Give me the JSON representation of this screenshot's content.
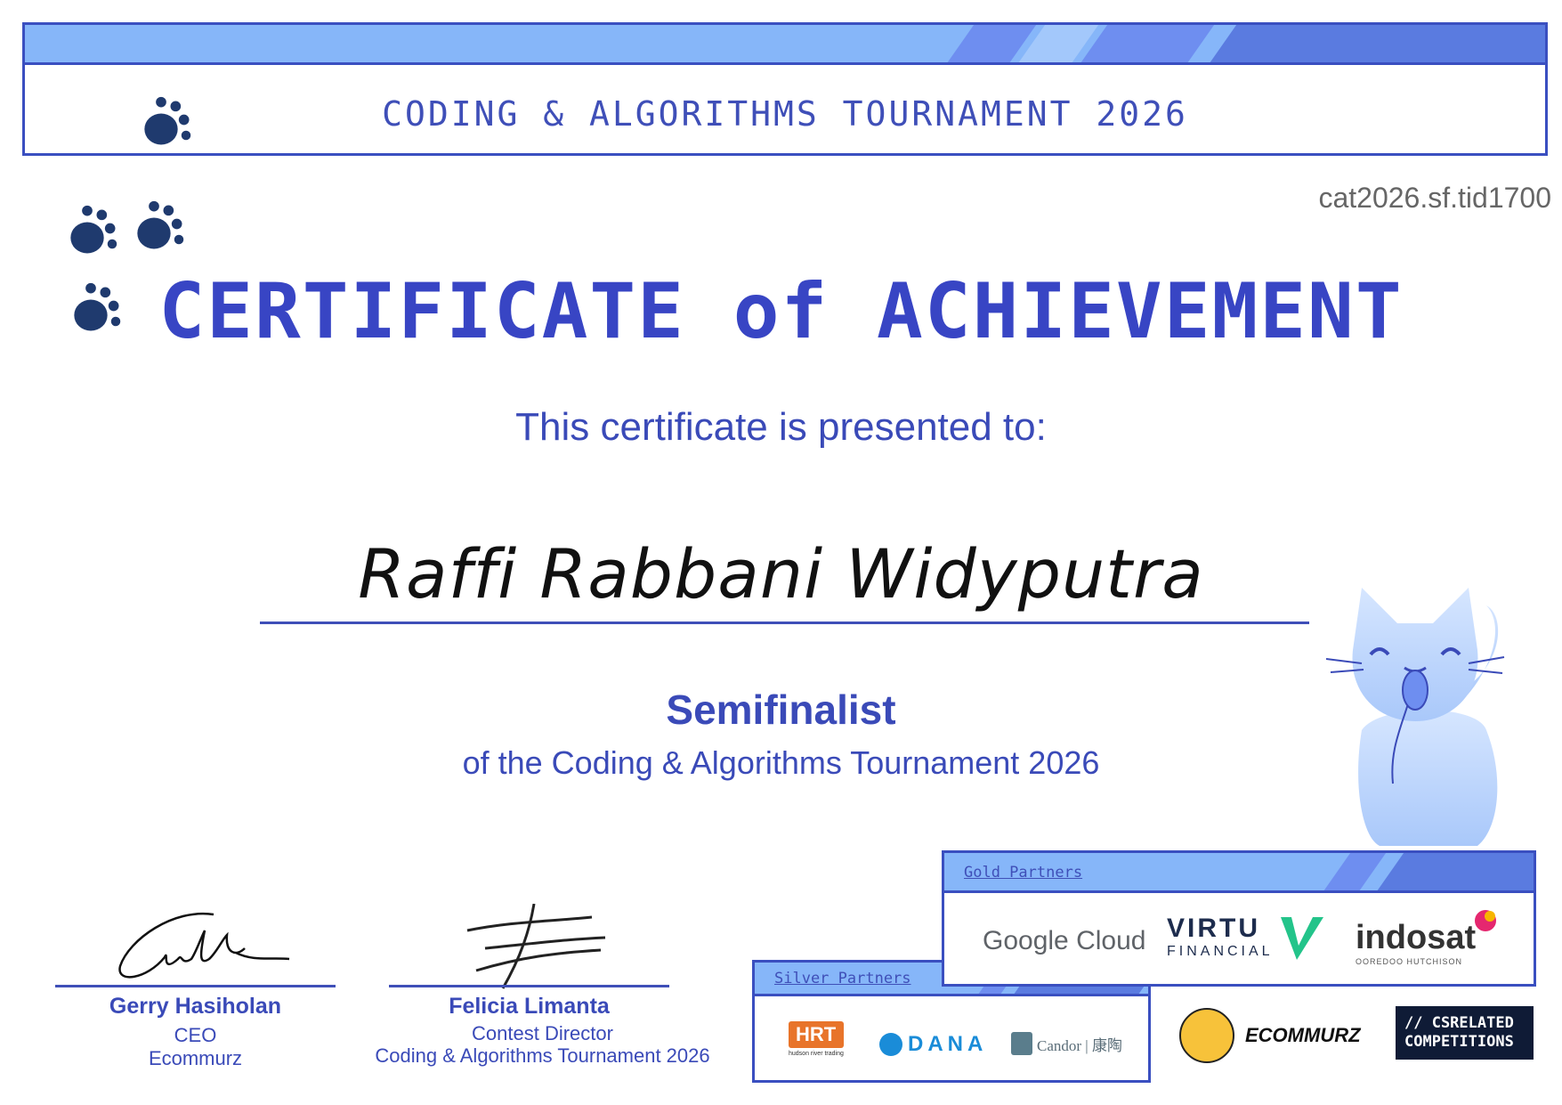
{
  "banner": {
    "title": "CODING & ALGORITHMS TOURNAMENT 2026"
  },
  "certificate": {
    "id": "cat2026.sf.tid1700",
    "title": "CERTIFICATE of ACHIEVEMENT",
    "presented_text": "This certificate is presented to:",
    "recipient": "Raffi Rabbani Widyputra",
    "award": "Semifinalist",
    "award_detail": "of the Coding & Algorithms Tournament 2026"
  },
  "signatories": [
    {
      "name": "Gerry Hasiholan",
      "role": "CEO",
      "org": "Ecommurz"
    },
    {
      "name": "Felicia Limanta",
      "role": "Contest Director",
      "org": "Coding & Algorithms Tournament 2026"
    }
  ],
  "partners": {
    "gold_label": "Gold Partners",
    "gold": [
      {
        "icon": "google-cloud-logo",
        "text": "Google Cloud"
      },
      {
        "icon": "virtu-financial-logo",
        "text": "VIRTU",
        "subtext": "FINANCIAL"
      },
      {
        "icon": "indosat-logo",
        "text": "indosat",
        "subtext": "OOREDOO HUTCHISON"
      }
    ],
    "silver_label": "Silver Partners",
    "silver": [
      {
        "icon": "hrt-logo",
        "text": "HRT",
        "subtext": "hudson river trading"
      },
      {
        "icon": "dana-logo",
        "text": "DANA"
      },
      {
        "icon": "candor-logo",
        "text": "Candor | 康陶"
      }
    ],
    "others": [
      {
        "icon": "ecommurz-logo",
        "text": "ECOMMURZ"
      },
      {
        "icon": "cs-related-competitions-logo",
        "text": "// CSRELATED COMPETITIONS"
      }
    ]
  },
  "colors": {
    "primary": "#3a4ab8",
    "banner": "#86b6f9",
    "accent": "#5a7be0",
    "paw": "#1f3a6e"
  }
}
